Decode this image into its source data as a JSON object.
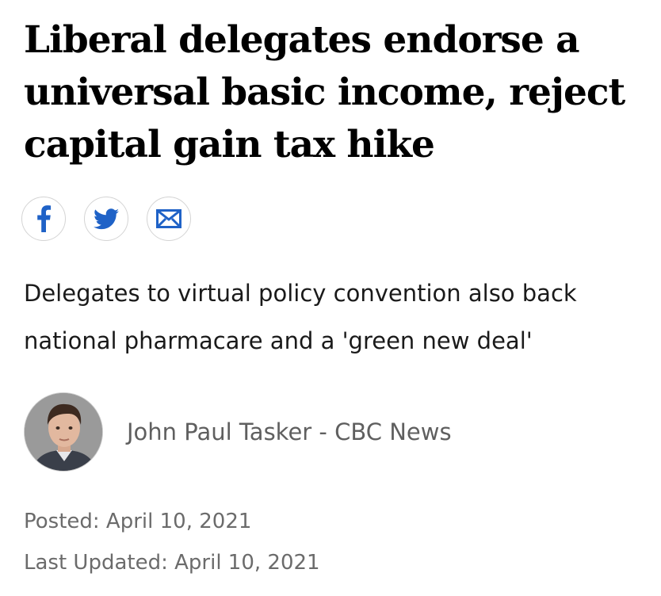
{
  "article": {
    "headline": "Liberal delegates endorse a universal basic income, reject capital gain tax hike",
    "deck": "Delegates to virtual policy convention also back national pharmacare and a 'green new deal'"
  },
  "share": {
    "icons": [
      "facebook-icon",
      "twitter-icon",
      "email-icon"
    ],
    "accent_color": "#1f62c7"
  },
  "byline": {
    "author": "John Paul Tasker - CBC News"
  },
  "dates": {
    "posted": "Posted: April 10, 2021",
    "updated": "Last Updated: April 10, 2021"
  }
}
